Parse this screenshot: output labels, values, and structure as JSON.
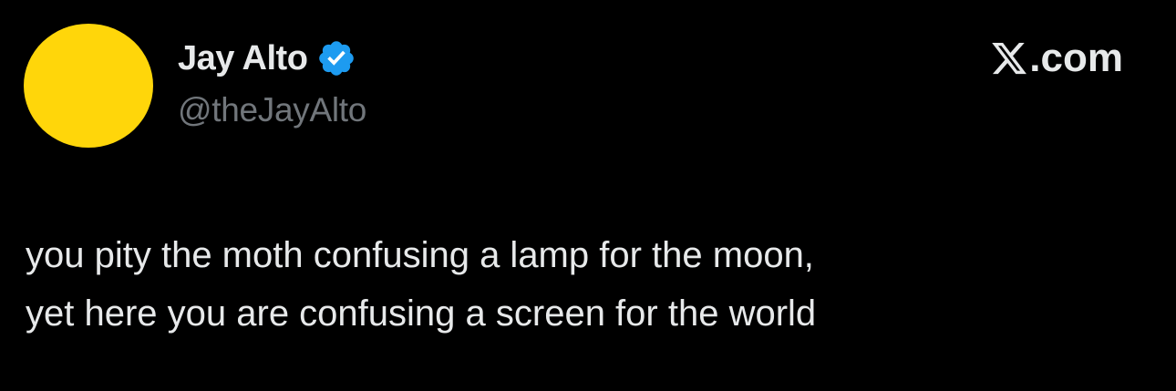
{
  "author": {
    "display_name": "Jay Alto",
    "handle": "@theJayAlto",
    "verified": true,
    "avatar_color": "#FFD60A"
  },
  "brand": {
    "icon": "x-logo-icon",
    "suffix": ".com"
  },
  "tweet": {
    "lines": [
      "you pity the moth confusing a lamp for the moon,",
      "yet here you are confusing a screen for the world"
    ]
  },
  "colors": {
    "background": "#000000",
    "primary_text": "#E7E9EA",
    "secondary_text": "#71767B",
    "verified_badge": "#1D9BF0"
  }
}
